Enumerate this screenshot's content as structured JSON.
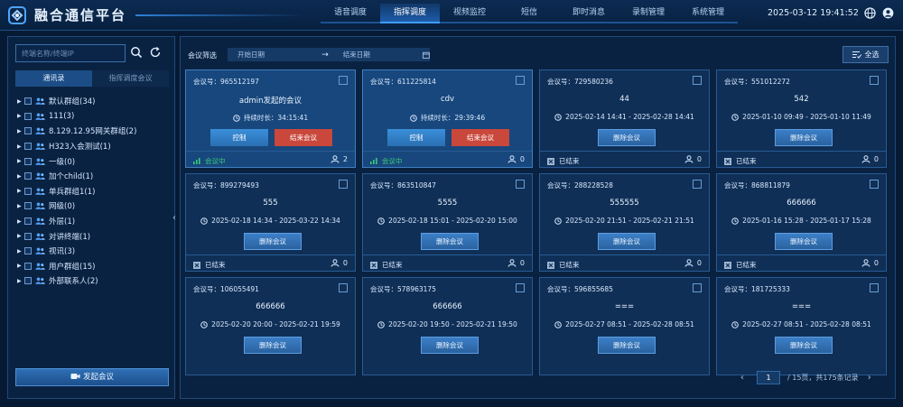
{
  "app": {
    "title": "融合通信平台"
  },
  "nav": {
    "tabs": [
      "语音调度",
      "指挥调度",
      "视频监控",
      "短信",
      "即时消息",
      "录制管理",
      "系统管理"
    ],
    "active_index": 1
  },
  "clock": "2025-03-12 19:41:52",
  "sidebar": {
    "search_placeholder": "终端名称/终端IP",
    "tabs": [
      "通讯录",
      "指挥调度会议"
    ],
    "active_tab": 0,
    "groups": [
      "默认群组(34)",
      "111(3)",
      "8.129.12.95网关群组(2)",
      "H323入会测试(1)",
      "一级(0)",
      "加个child(1)",
      "单兵群组1(1)",
      "网级(0)",
      "外层(1)",
      "对讲终端(1)",
      "视讯(3)",
      "用户群组(15)",
      "外部联系人(2)"
    ],
    "start_meeting": "发起会议"
  },
  "filter": {
    "label": "会议筛选",
    "start_placeholder": "开始日期",
    "end_placeholder": "结束日期",
    "select_all": "全选"
  },
  "colors": {
    "accent": "#3f9dff",
    "live": "#3ccc7a",
    "danger": "#c9473b"
  },
  "labels": {
    "id_prefix": "会议号：",
    "duration_prefix": "持续时长：",
    "control": "控制",
    "end": "结束会议",
    "delete": "删除会议"
  },
  "meetings": [
    {
      "id": "965512197",
      "name": "admin发起的会议",
      "time": "34:15:41",
      "status": "会议中",
      "count": "2",
      "active": true
    },
    {
      "id": "611225814",
      "name": "cdv",
      "time": "29:39:46",
      "status": "会议中",
      "count": "0",
      "active": true
    },
    {
      "id": "729580236",
      "name": "44",
      "time": "2025-02-14 14:41 - 2025-02-28 14:41",
      "status": "已结束",
      "count": "0",
      "active": false
    },
    {
      "id": "551012272",
      "name": "542",
      "time": "2025-01-10 09:49 - 2025-01-10 11:49",
      "status": "已结束",
      "count": "0",
      "active": false
    },
    {
      "id": "899279493",
      "name": "555",
      "time": "2025-02-18 14:34 - 2025-03-22 14:34",
      "status": "已结束",
      "count": "0",
      "active": false
    },
    {
      "id": "863510847",
      "name": "5555",
      "time": "2025-02-18 15:01 - 2025-02-20 15:00",
      "status": "已结束",
      "count": "0",
      "active": false
    },
    {
      "id": "288228528",
      "name": "555555",
      "time": "2025-02-20 21:51 - 2025-02-21 21:51",
      "status": "已结束",
      "count": "0",
      "active": false
    },
    {
      "id": "868811879",
      "name": "666666",
      "time": "2025-01-16 15:28 - 2025-01-17 15:28",
      "status": "已结束",
      "count": "0",
      "active": false
    },
    {
      "id": "106055491",
      "name": "666666",
      "time": "2025-02-20 20:00 - 2025-02-21 19:59",
      "status": "",
      "count": "",
      "active": false
    },
    {
      "id": "578963175",
      "name": "666666",
      "time": "2025-02-20 19:50 - 2025-02-21 19:50",
      "status": "",
      "count": "",
      "active": false
    },
    {
      "id": "596855685",
      "name": "===",
      "time": "2025-02-27 08:51 - 2025-02-28 08:51",
      "status": "",
      "count": "",
      "active": false
    },
    {
      "id": "181725333",
      "name": "===",
      "time": "2025-02-27 08:51 - 2025-02-28 08:51",
      "status": "",
      "count": "",
      "active": false
    }
  ],
  "pagination": {
    "current": "1",
    "info": "/ 15页，共175条记录"
  }
}
